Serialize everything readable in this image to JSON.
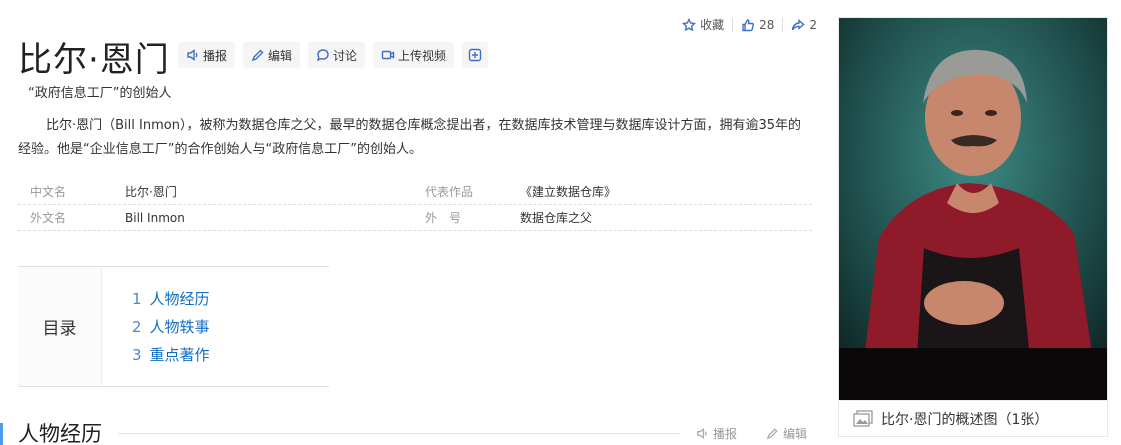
{
  "title": "比尔·恩门",
  "toolbar": {
    "play_label": "播报",
    "edit_label": "编辑",
    "discuss_label": "讨论",
    "upload_video_label": "上传视频"
  },
  "top_actions": {
    "favorite_label": "收藏",
    "like_count": "28",
    "share_count": "2"
  },
  "subtitle": "“政府信息工厂”的创始人",
  "summary": "比尔·恩门（Bill Inmon），被称为数据仓库之父，最早的数据仓库概念提出者，在数据库技术管理与数据库设计方面，拥有逾35年的经验。他是“企业信息工厂”的合作创始人与“政府信息工厂”的创始人。",
  "info": [
    {
      "k1": "中文名",
      "v1": "比尔·恩门",
      "k2": "代表作品",
      "v2": "《建立数据仓库》"
    },
    {
      "k1": "外文名",
      "v1": "Bill Inmon",
      "k2": "外　号",
      "v2": "数据仓库之父"
    }
  ],
  "toc": {
    "label": "目录",
    "items": [
      {
        "num": "1",
        "label": "人物经历"
      },
      {
        "num": "2",
        "label": "人物轶事"
      },
      {
        "num": "3",
        "label": "重点著作"
      }
    ]
  },
  "photo_caption": "比尔·恩门的概述图（1张）",
  "section": {
    "heading": "人物经历",
    "play_label": "播报",
    "edit_label": "编辑"
  },
  "colors": {
    "link": "#136ec2",
    "icon": "#3f6fc4",
    "section_bar": "#4f9cee"
  }
}
